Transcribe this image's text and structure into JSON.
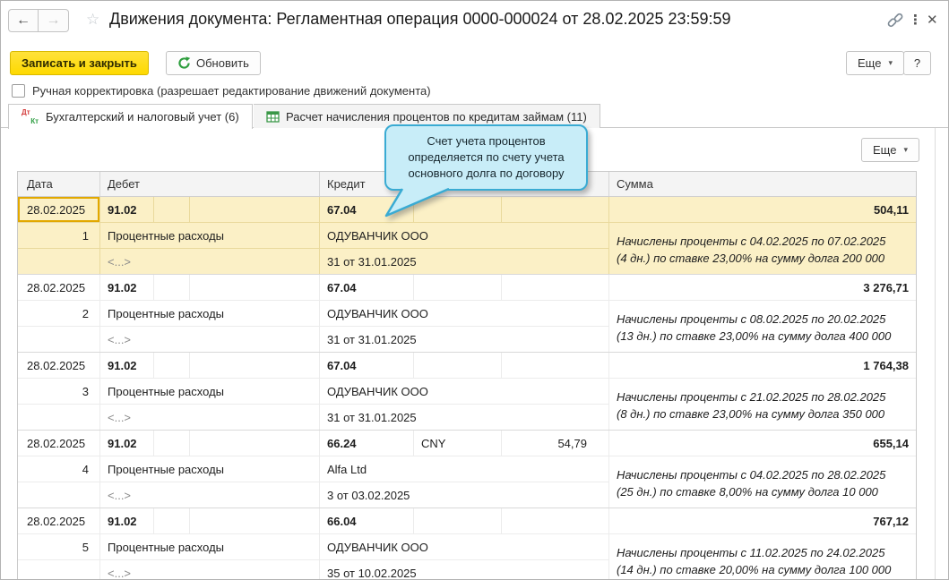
{
  "colors": {
    "accent_button": "#ffdd2d",
    "row_highlight": "#fbf0c6",
    "selected_cell_border": "#e2a800",
    "tooltip_bg": "#c8edf8",
    "tooltip_border": "#3aabd3",
    "refresh_icon_green": "#2e9e3e",
    "debit_red": "#d43c3c",
    "credit_green": "#2f9e43"
  },
  "icons": {
    "back": "←",
    "forward": "→",
    "star": "☆",
    "kebab": "⋮",
    "close": "✕",
    "drop_arrow": "▾",
    "dt": "Дт",
    "kt": "Кт"
  },
  "titlebar": {
    "title": "Движения документа: Регламентная операция 0000-000024 от 28.02.2025 23:59:59"
  },
  "toolbar": {
    "save_close_label": "Записать и закрыть",
    "refresh_label": "Обновить",
    "more_label": "Еще",
    "help_label": "?"
  },
  "checkbox": {
    "label": "Ручная корректировка (разрешает редактирование движений документа)",
    "checked": false
  },
  "tabs": [
    {
      "label": "Бухгалтерский и налоговый учет (6)",
      "active": true
    },
    {
      "label": "Расчет начисления процентов по кредитам займам (11)",
      "active": false
    }
  ],
  "panel": {
    "more_label": "Еще"
  },
  "tooltip": {
    "text": "Счет учета процентов\nопределяется по счету учета\nосновного долга по договору"
  },
  "table": {
    "headers": {
      "date": "Дата",
      "debit": "Дебет",
      "credit": "Кредит",
      "sum": "Сумма"
    },
    "rows": [
      {
        "date": "28.02.2025",
        "num": "1",
        "debit_account": "91.02",
        "debit_sub1": "Процентные расходы",
        "debit_sub2": "<...>",
        "credit_account": "67.04",
        "credit_cur": "",
        "credit_cur_amount": "",
        "credit_sub1": "ОДУВАНЧИК ООО",
        "credit_sub2": "31 от 31.01.2025",
        "sum": "504,11",
        "comment": "Начислены проценты с 04.02.2025 по 07.02.2025\n(4 дн.) по ставке 23,00% на сумму долга 200 000",
        "selected": true
      },
      {
        "date": "28.02.2025",
        "num": "2",
        "debit_account": "91.02",
        "debit_sub1": "Процентные расходы",
        "debit_sub2": "<...>",
        "credit_account": "67.04",
        "credit_cur": "",
        "credit_cur_amount": "",
        "credit_sub1": "ОДУВАНЧИК ООО",
        "credit_sub2": "31 от 31.01.2025",
        "sum": "3 276,71",
        "comment": "Начислены проценты с 08.02.2025 по 20.02.2025\n(13 дн.) по ставке 23,00% на сумму долга 400 000",
        "selected": false
      },
      {
        "date": "28.02.2025",
        "num": "3",
        "debit_account": "91.02",
        "debit_sub1": "Процентные расходы",
        "debit_sub2": "<...>",
        "credit_account": "67.04",
        "credit_cur": "",
        "credit_cur_amount": "",
        "credit_sub1": "ОДУВАНЧИК ООО",
        "credit_sub2": "31 от 31.01.2025",
        "sum": "1 764,38",
        "comment": "Начислены проценты с 21.02.2025 по 28.02.2025\n(8 дн.) по ставке 23,00% на сумму долга 350 000",
        "selected": false
      },
      {
        "date": "28.02.2025",
        "num": "4",
        "debit_account": "91.02",
        "debit_sub1": "Процентные расходы",
        "debit_sub2": "<...>",
        "credit_account": "66.24",
        "credit_cur": "CNY",
        "credit_cur_amount": "54,79",
        "credit_sub1": "Alfa Ltd",
        "credit_sub2": "3 от 03.02.2025",
        "sum": "655,14",
        "comment": "Начислены проценты с 04.02.2025 по 28.02.2025\n(25 дн.) по ставке 8,00% на сумму долга 10 000",
        "selected": false
      },
      {
        "date": "28.02.2025",
        "num": "5",
        "debit_account": "91.02",
        "debit_sub1": "Процентные расходы",
        "debit_sub2": "<...>",
        "credit_account": "66.04",
        "credit_cur": "",
        "credit_cur_amount": "",
        "credit_sub1": "ОДУВАНЧИК ООО",
        "credit_sub2": "35 от 10.02.2025",
        "sum": "767,12",
        "comment": "Начислены проценты с 11.02.2025 по 24.02.2025\n(14 дн.) по ставке 20,00% на сумму долга 100 000",
        "selected": false
      }
    ]
  }
}
